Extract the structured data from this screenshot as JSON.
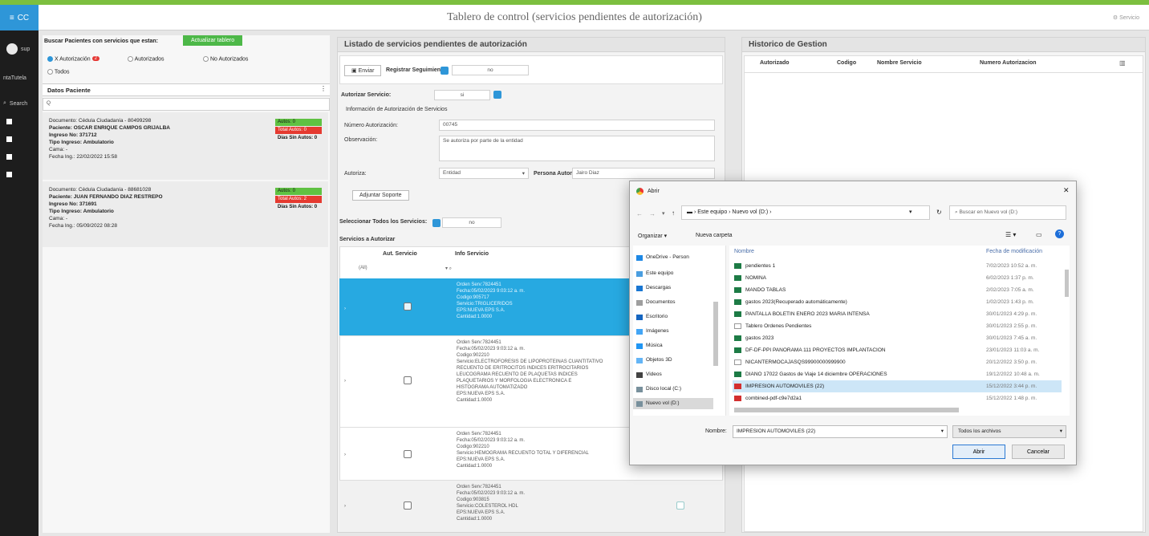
{
  "header": {
    "title": "Tablero de control (servicios pendientes de autorización)",
    "menu_label": "CC",
    "right_text": "Servicio"
  },
  "sidebar": {
    "user_short": "sup",
    "items": [
      "ntaTutela",
      "Search"
    ]
  },
  "left": {
    "search_label": "Buscar Pacientes con servicios que estan:",
    "refresh_button": "Actualizar tablero",
    "filters": [
      {
        "label": "X Autorización",
        "badge": "2",
        "on": true
      },
      {
        "label": "Autorizados",
        "on": false
      },
      {
        "label": "No Autorizados",
        "on": false
      },
      {
        "label": "Todos",
        "on": false
      }
    ],
    "section_title": "Datos Paciente",
    "search_placeholder": "Q",
    "patients": [
      {
        "doc": "Documento: Cédula Ciudadanía - 80499298",
        "name": "Paciente: OSCAR ENRIQUE CAMPOS GRIJALBA",
        "ingreso": "Ingreso No: 371712",
        "tipo": "Tipo Ingreso: Ambulatorio",
        "cama": "Cama: -",
        "fecha": "Fecha Ing.: 22/02/2022 15:58",
        "t1": "Autos: 0",
        "t2": "Total Autos: 0",
        "t3": "Días Sin Autos: 0"
      },
      {
        "doc": "Documento: Cédula Ciudadanía - 88681028",
        "name": "Paciente: JUAN FERNANDO DIAZ RESTREPO",
        "ingreso": "Ingreso No: 371691",
        "tipo": "Tipo Ingreso: Ambulatorio",
        "cama": "Cama: -",
        "fecha": "Fecha Ing.: 05/09/2022 08:28",
        "t1": "Autos: 0",
        "t2": "Total Autos: 2",
        "t3": "Días Sin Autos: 0"
      }
    ]
  },
  "mid": {
    "title": "Listado de servicios pendientes de autorización",
    "send_button": "Enviar",
    "seq_label": "Registrar Seguimiento:",
    "seq_value": "no",
    "auth_label": "Autorizar Servicio:",
    "auth_value": "si",
    "info_title": "Información de Autorización de Servicios",
    "num_label": "Número Autorización:",
    "num_value": "00745",
    "obs_label": "Observación:",
    "obs_value": "Se autoriza por parte de la entidad",
    "autoriza_label": "Autoriza:",
    "autoriza_value": "Entidad",
    "persona_label": "Persona Autoriza:",
    "persona_value": "Jairo Diaz",
    "adjuntar_button": "Adjuntar Soporte",
    "select_all_label": "Seleccionar Todos los Servicios:",
    "select_all_value": "no",
    "services_title": "Servicios a Autorizar",
    "col1": "Aut. Servicio",
    "col2": "Info Servicio",
    "filter_value": "(All)",
    "services": [
      {
        "lines": [
          "Orden Serv:7824451",
          "Fecha:05/02/2023 9:03:12 a. m.",
          "Codigo:905717",
          "Servicio:TRIGLICERIDOS",
          "EPS:NUEVA EPS S.A.",
          "Cantidad:1.0000"
        ],
        "checked": true,
        "sel": true
      },
      {
        "lines": [
          "Orden Serv:7824451",
          "Fecha:05/02/2023 9:03:12 a. m.",
          "Codigo:902210",
          "Servicio:ELECTROFORESIS DE LIPOPROTEINAS CUANTITATIVO",
          "RECUENTO DE ERITROCITOS INDICES ERITROCITARIOS",
          "LEUCOGRAMA RECUENTO DE PLAQUETAS INDICES",
          "PLAQUETARIOS Y MORFOLOGIA ELECTRONICA E",
          "HISTOGRAMA AUTOMATIZADO",
          "EPS:NUEVA EPS S.A.",
          "Cantidad:1.0000"
        ],
        "checked": false,
        "sel": false
      },
      {
        "lines": [
          "Orden Serv:7824451",
          "Fecha:05/02/2023 9:03:12 a. m.",
          "Codigo:902210",
          "Servicio:HEMOGRAMA RECUENTO TOTAL Y DIFERENCIAL",
          "EPS:NUEVA EPS S.A.",
          "Cantidad:1.0000"
        ],
        "checked": false,
        "sel": false
      },
      {
        "lines": [
          "Orden Serv:7824451",
          "Fecha:05/02/2023 9:03:12 a. m.",
          "Codigo:903815",
          "Servicio:COLESTEROL HDL",
          "EPS:NUEVA EPS S.A.",
          "Cantidad:1.0000"
        ],
        "checked": false,
        "sel": false
      }
    ]
  },
  "right": {
    "title": "Historico de Gestion",
    "cols": [
      "Autorizado",
      "Codigo",
      "Nombre Servicio",
      "Numero Autorizacion"
    ]
  },
  "dialog": {
    "title": "Abrir",
    "path": "Este equipo › Nuevo vol (D:) ›",
    "search_placeholder": "Buscar en Nuevo vol (D:)",
    "organize": "Organizar ▾",
    "new_folder": "Nueva carpeta",
    "col_name": "Nombre",
    "col_date": "Fecha de modificación",
    "nav": [
      "OneDrive - Person",
      "Este equipo",
      "Descargas",
      "Documentos",
      "Escritorio",
      "Imágenes",
      "Música",
      "Objetos 3D",
      "Videos",
      "Disco local (C:)",
      "Nuevo vol (D:)"
    ],
    "files": [
      {
        "name": "pendientes 1",
        "date": "7/02/2023 10:52 a. m.",
        "t": "x"
      },
      {
        "name": "NOMINA",
        "date": "6/02/2023 1:37 p. m.",
        "t": "x"
      },
      {
        "name": "MANDO TABLAS",
        "date": "2/02/2023 7:05 a. m.",
        "t": "x"
      },
      {
        "name": "gastos 2023(Recuperado automáticamente)",
        "date": "1/02/2023 1:43 p. m.",
        "t": "x"
      },
      {
        "name": "PANTALLA BOLETIN ENERO 2023 MARIA INTENSA",
        "date": "30/01/2023 4:29 p. m.",
        "t": "x"
      },
      {
        "name": "Tablero Ordenes Pendientes",
        "date": "30/01/2023 2:55 p. m.",
        "t": "d"
      },
      {
        "name": "gastos 2023",
        "date": "30/01/2023 7:45 a. m.",
        "t": "x"
      },
      {
        "name": "DF-DF-PPI PANORAMA 111 PROYECTOS IMPLANTACION",
        "date": "23/01/2023 11:03 a. m.",
        "t": "x"
      },
      {
        "name": "NICANTERMOCAJASQS99900000999900",
        "date": "20/12/2022 3:50 p. m.",
        "t": "d"
      },
      {
        "name": "DIANO 17022 Gastos de Viaje 14 diciembre OPERACIONES",
        "date": "19/12/2022 10:48 a. m.",
        "t": "x"
      },
      {
        "name": "IMPRESION AUTOMOVILES (22)",
        "date": "15/12/2022 3:44 p. m.",
        "t": "p",
        "sel": true
      },
      {
        "name": "combined-pdf-c9e7d2a1",
        "date": "15/12/2022 1:48 p. m.",
        "t": "p"
      }
    ],
    "filename_label": "Nombre:",
    "filename_value": "IMPRESION AUTOMOVILES (22)",
    "filter_value": "Todos los archivos",
    "open_button": "Abrir",
    "cancel_button": "Cancelar"
  }
}
